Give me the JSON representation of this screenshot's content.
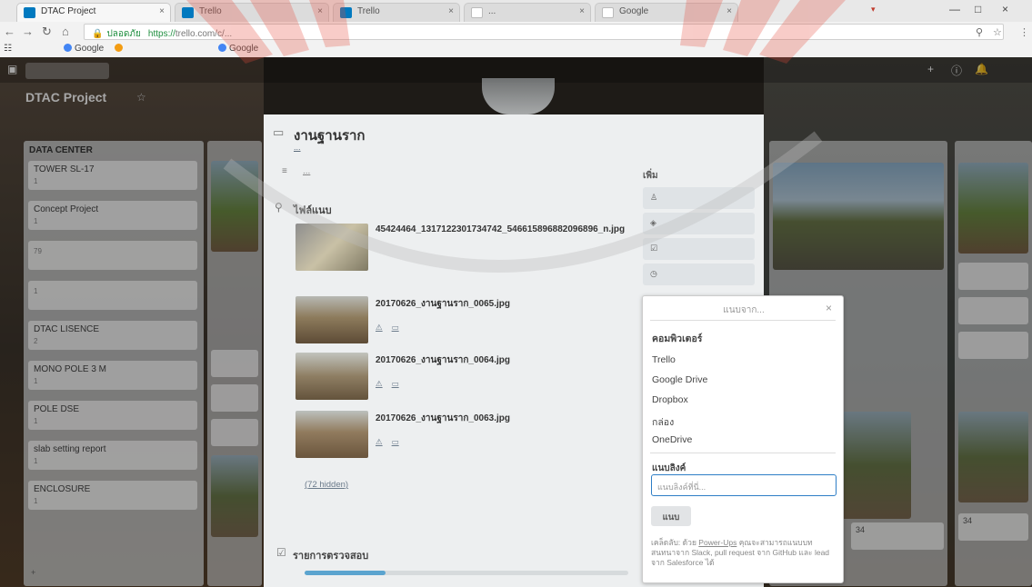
{
  "browser": {
    "tabs": [
      {
        "label": "Trello"
      },
      {
        "label": "Trello"
      },
      {
        "label": "Google"
      }
    ],
    "address": {
      "secure_label": "ปลอดภัย",
      "url_https": "https://",
      "url_host": "trello.com"
    },
    "bookmarks": [
      {
        "label": "Google"
      },
      {
        "label": "Google"
      }
    ],
    "window_controls": {
      "minimize": "—",
      "close": "×"
    }
  },
  "board": {
    "title": "DTAC Project",
    "lists": [
      {
        "title": "DATA CENTER",
        "cards": [
          {
            "title": "TOWER SL-17",
            "meta": "1"
          },
          {
            "title": "Concept Project",
            "meta": "1"
          },
          {
            "title": "",
            "meta": "79"
          },
          {
            "title": "",
            "meta": "1"
          },
          {
            "title": "DTAC LISENCE",
            "meta": "2"
          },
          {
            "title": "MONO POLE 3 M",
            "meta": "1"
          },
          {
            "title": "POLE DSE",
            "meta": "1"
          },
          {
            "title": "slab setting report",
            "meta": "1"
          },
          {
            "title": "ENCLOSURE",
            "meta": "1"
          }
        ]
      }
    ],
    "right_lists": [
      {
        "title": "",
        "badge": "34"
      },
      {
        "title": "",
        "badge": "34"
      }
    ]
  },
  "card_detail": {
    "title": "งานฐานราก",
    "attachments_heading": "ไฟล์แนบ",
    "attachments": [
      {
        "name": "45424464_1317122301734742_546615896882096896_n.jpg",
        "date": ""
      },
      {
        "name": "20170626_งานฐานราก_0065.jpg",
        "date": ""
      },
      {
        "name": "20170626_งานฐานราก_0064.jpg",
        "date": ""
      },
      {
        "name": "20170626_งานฐานราก_0063.jpg",
        "date": ""
      }
    ],
    "show_hidden_link": "(72 hidden)",
    "checklist": {
      "title": "รายการตรวจสอบ",
      "progress": 0.25
    },
    "sidebar_heading": "เพิ่ม",
    "sidebar_buttons": [
      {
        "label": ""
      },
      {
        "label": ""
      },
      {
        "label": ""
      },
      {
        "label": ""
      }
    ]
  },
  "attach_popover": {
    "title": "แนบจาก...",
    "computer_label": "คอมพิวเตอร์",
    "sources": [
      "Trello",
      "Google Drive",
      "Dropbox",
      "กล่อง",
      "OneDrive"
    ],
    "link_label": "แนบลิงค์",
    "link_placeholder": "แนบลิงค์ที่นี่...",
    "attach_button": "แนบ",
    "tip_link": "Power-Ups",
    "tip_pre": "เคล็ดลับ: ด้วย",
    "tip_post": "คุณจะสามารถแนบบทสนทนาจาก Slack, pull request จาก GitHub และ lead จาก Salesforce ได้"
  },
  "colors": {
    "trello_blue": "#0079bf",
    "input_focus": "#2e7ec6",
    "progress_fill": "#5ba4cf",
    "watermark": "#e74c3c"
  },
  "icons": [
    "back-icon",
    "forward-icon",
    "reload-icon",
    "home-icon",
    "lock-icon",
    "star-icon",
    "close-icon",
    "paperclip-icon",
    "checklist-icon",
    "card-icon",
    "description-icon"
  ]
}
